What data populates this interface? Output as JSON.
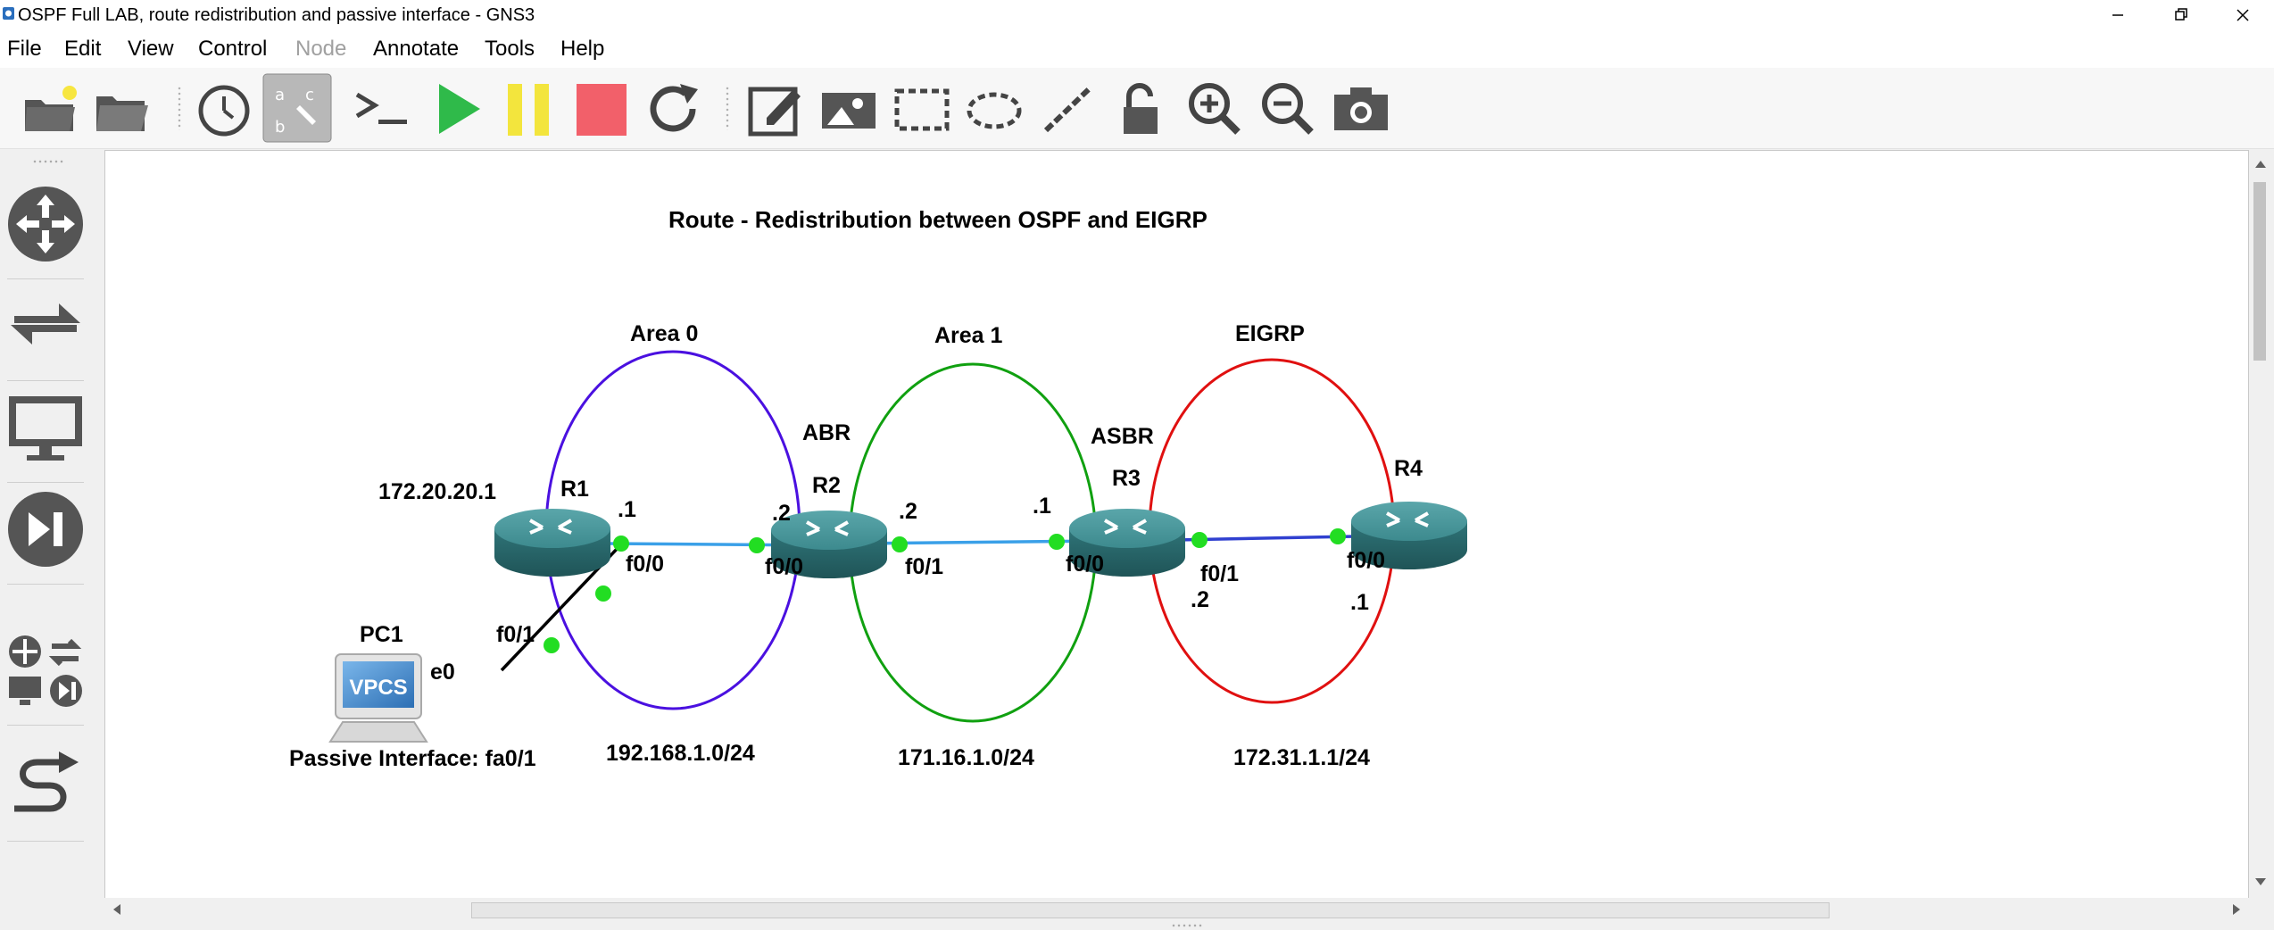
{
  "window": {
    "title": "OSPF Full LAB, route redistribution and passive interface - GNS3",
    "controls": [
      "minimize-icon",
      "restore-icon",
      "close-icon"
    ]
  },
  "menu": {
    "items": [
      {
        "label": "File",
        "enabled": true
      },
      {
        "label": "Edit",
        "enabled": true
      },
      {
        "label": "View",
        "enabled": true
      },
      {
        "label": "Control",
        "enabled": true
      },
      {
        "label": "Node",
        "enabled": false
      },
      {
        "label": "Annotate",
        "enabled": true
      },
      {
        "label": "Tools",
        "enabled": true
      },
      {
        "label": "Help",
        "enabled": true
      }
    ]
  },
  "toolbar": {
    "buttons": [
      "new-project-icon",
      "open-project-icon",
      "snapshot-clock-icon",
      "show-labels-icon",
      "console-all-icon",
      "start-all-icon",
      "suspend-all-icon",
      "stop-all-icon",
      "reload-all-icon",
      "add-note-icon",
      "insert-image-icon",
      "draw-rectangle-icon",
      "draw-ellipse-icon",
      "draw-line-icon",
      "lock-items-icon",
      "zoom-in-icon",
      "zoom-out-icon",
      "screenshot-icon"
    ],
    "active_button": "show-labels-icon"
  },
  "sidebar": {
    "items": [
      "browse-routers-icon",
      "browse-switches-icon",
      "browse-end-devices-icon",
      "browse-security-devices-icon",
      "browse-all-devices-icon",
      "add-link-icon"
    ]
  },
  "colors": {
    "area0": "#4a10e0",
    "area1": "#10a010",
    "eigrp": "#e01010",
    "link_ospf": "#3aa0e8",
    "link_eigrp": "#3040d0",
    "port_dot": "#22dd22",
    "router_body": "#3d8a8e"
  },
  "topology": {
    "title": "Route - Redistribution between OSPF and EIGRP",
    "zones": {
      "area0": "Area 0",
      "area1": "Area 1",
      "eigrp": "EIGRP"
    },
    "roles": {
      "abr": "ABR",
      "asbr": "ASBR"
    },
    "nodes": {
      "r1": "R1",
      "r2": "R2",
      "r3": "R3",
      "r4": "R4",
      "pc1": "PC1",
      "vpcs": "VPCS"
    },
    "r1_address": "172.20.20.1",
    "ports": {
      "r1_f00": "f0/0",
      "r1_f01": "f0/1",
      "r2_f00": "f0/0",
      "r2_f01": "f0/1",
      "r3_f00": "f0/0",
      "r3_f01": "f0/1",
      "r4_f00": "f0/0",
      "pc1_e0": "e0"
    },
    "hosts": {
      "r1_a": ".1",
      "r2_a": ".2",
      "r2_b": ".2",
      "r3_a": ".1",
      "r3_b": ".2",
      "r4_a": ".1"
    },
    "networks": {
      "net1": "192.168.1.0/24",
      "net2": "171.16.1.0/24",
      "net3": "172.31.1.1/24"
    },
    "passive_note": "Passive Interface: fa0/1"
  }
}
